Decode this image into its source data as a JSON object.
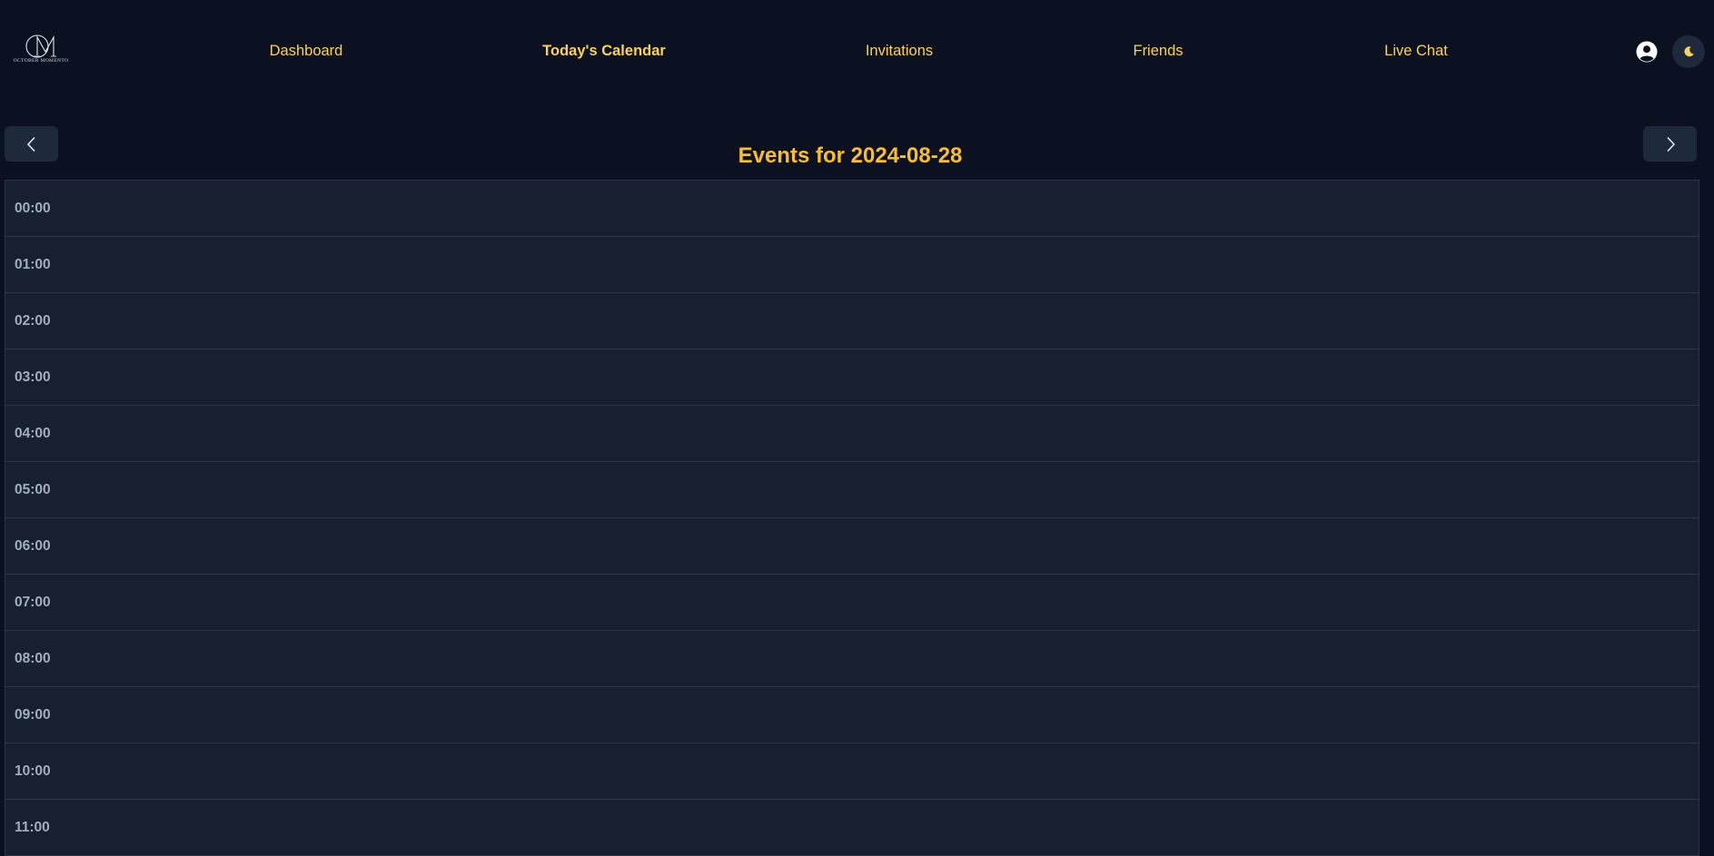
{
  "brand": {
    "monogram": "OM",
    "name": "OCTOBER MOMENTO"
  },
  "nav": {
    "items": [
      {
        "label": "Dashboard",
        "active": false
      },
      {
        "label": "Today's Calendar",
        "active": true
      },
      {
        "label": "Invitations",
        "active": false
      },
      {
        "label": "Friends",
        "active": false
      },
      {
        "label": "Live Chat",
        "active": false
      }
    ],
    "user_icon": "user-circle-icon",
    "theme_icon": "moon-icon"
  },
  "calendar": {
    "title": "Events for 2024-08-28",
    "prev_icon": "chevron-left-icon",
    "next_icon": "chevron-right-icon",
    "hours": [
      "00:00",
      "01:00",
      "02:00",
      "03:00",
      "04:00",
      "05:00",
      "06:00",
      "07:00",
      "08:00",
      "09:00",
      "10:00",
      "11:00"
    ]
  },
  "colors": {
    "background": "#0b1120",
    "accent": "#fbbf24",
    "nav_text": "#fcd34d",
    "row_background": "#172030",
    "row_border": "#2c3645",
    "hour_label": "#a0aec0",
    "button_background": "#1e293b"
  }
}
